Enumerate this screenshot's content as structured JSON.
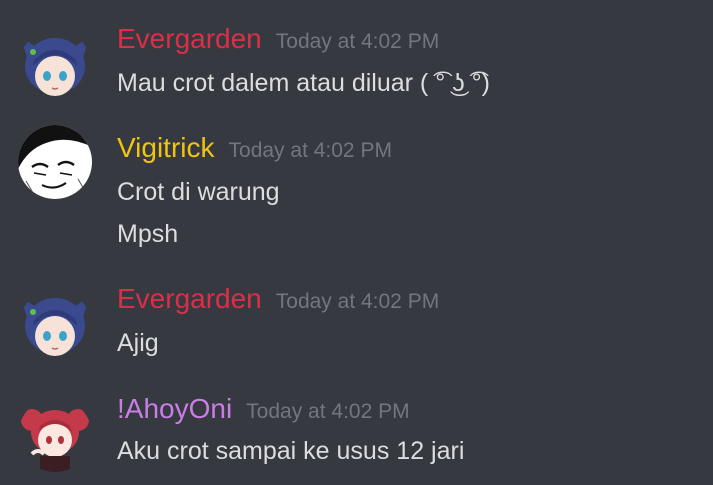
{
  "colors": {
    "background": "#36393f",
    "evergarden": "#dc2f47",
    "vigitrick": "#f1c40f",
    "ahoyoni": "#c97ee6",
    "timestamp": "#72767d",
    "text": "#dcddde"
  },
  "messages": [
    {
      "author": "Evergarden",
      "timestamp": "Today at 4:02 PM",
      "avatar_icon": "anime-girl-blue-hair-avatar",
      "lines": [
        "Mau crot dalem atau diluar  ( ͡° ͜ʖ ͡°)"
      ]
    },
    {
      "author": "Vigitrick",
      "timestamp": "Today at 4:02 PM",
      "avatar_icon": "manga-face-avatar",
      "lines": [
        "Crot di warung",
        "Mpsh"
      ]
    },
    {
      "author": "Evergarden",
      "timestamp": "Today at 4:02 PM",
      "avatar_icon": "anime-girl-blue-hair-avatar",
      "lines": [
        "Ajig"
      ]
    },
    {
      "author": "!AhoyOni",
      "timestamp": "Today at 4:02 PM",
      "avatar_icon": "anime-girl-red-hair-avatar",
      "lines": [
        "Aku crot sampai ke usus 12 jari"
      ]
    }
  ]
}
